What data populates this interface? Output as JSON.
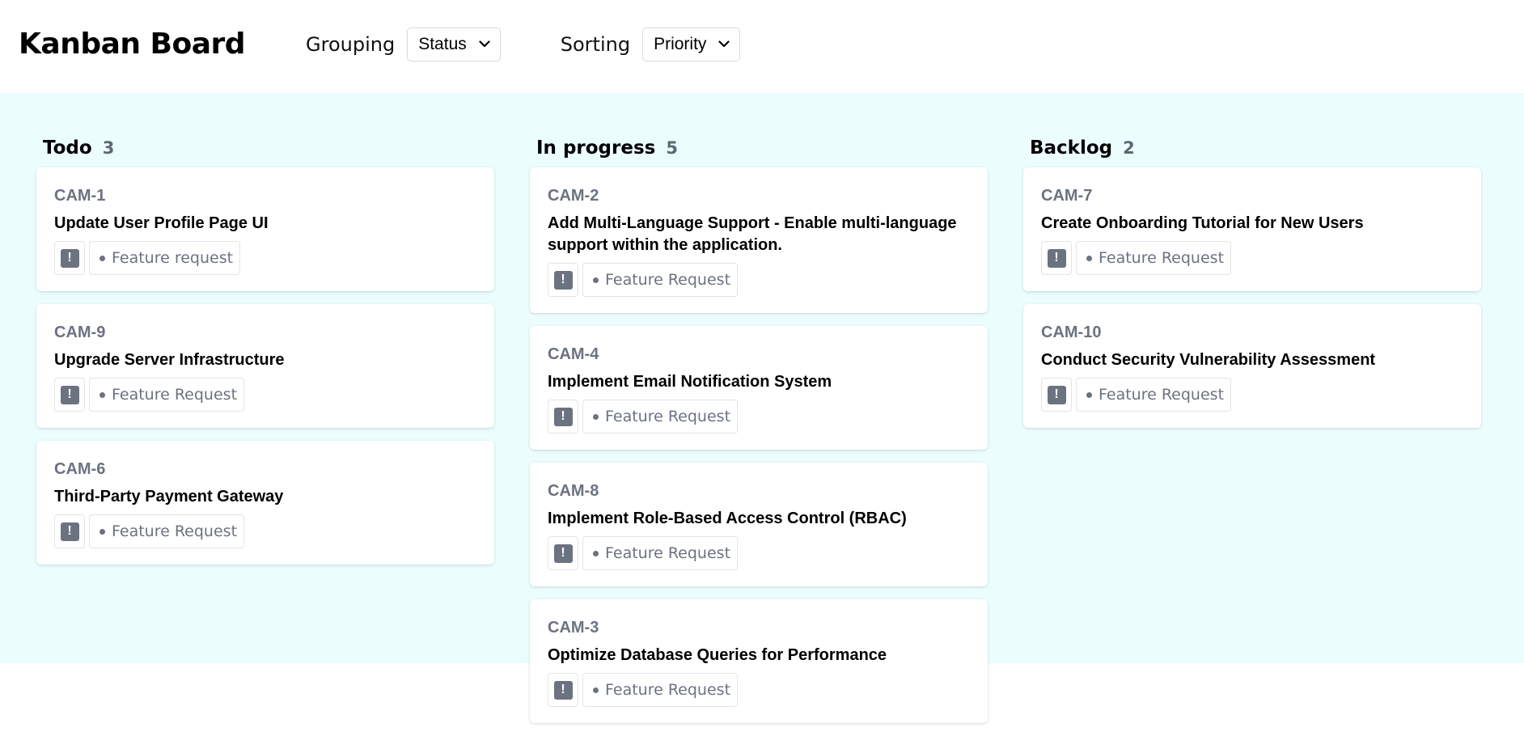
{
  "header": {
    "title": "Kanban Board",
    "grouping": {
      "label": "Grouping",
      "value": "Status"
    },
    "sorting": {
      "label": "Sorting",
      "value": "Priority"
    }
  },
  "colors": {
    "board_bg": "#ebfdfd",
    "muted": "#6b7280"
  },
  "columns": [
    {
      "title": "Todo",
      "count": "3",
      "cards": [
        {
          "id": "CAM-1",
          "title": "Update User Profile Page UI",
          "priority_icon": "!",
          "tag": "Feature request"
        },
        {
          "id": "CAM-9",
          "title": "Upgrade Server Infrastructure",
          "priority_icon": "!",
          "tag": "Feature Request"
        },
        {
          "id": "CAM-6",
          "title": "Third-Party Payment Gateway",
          "priority_icon": "!",
          "tag": "Feature Request"
        }
      ]
    },
    {
      "title": "In progress",
      "count": "5",
      "cards": [
        {
          "id": "CAM-2",
          "title": "Add Multi-Language Support - Enable multi-language support within the application.",
          "priority_icon": "!",
          "tag": "Feature Request"
        },
        {
          "id": "CAM-4",
          "title": "Implement Email Notification System",
          "priority_icon": "!",
          "tag": "Feature Request"
        },
        {
          "id": "CAM-8",
          "title": "Implement Role-Based Access Control (RBAC)",
          "priority_icon": "!",
          "tag": "Feature Request"
        },
        {
          "id": "CAM-3",
          "title": "Optimize Database Queries for Performance",
          "priority_icon": "!",
          "tag": "Feature Request"
        }
      ]
    },
    {
      "title": "Backlog",
      "count": "2",
      "cards": [
        {
          "id": "CAM-7",
          "title": "Create Onboarding Tutorial for New Users",
          "priority_icon": "!",
          "tag": "Feature Request"
        },
        {
          "id": "CAM-10",
          "title": "Conduct Security Vulnerability Assessment",
          "priority_icon": "!",
          "tag": "Feature Request"
        }
      ]
    }
  ]
}
